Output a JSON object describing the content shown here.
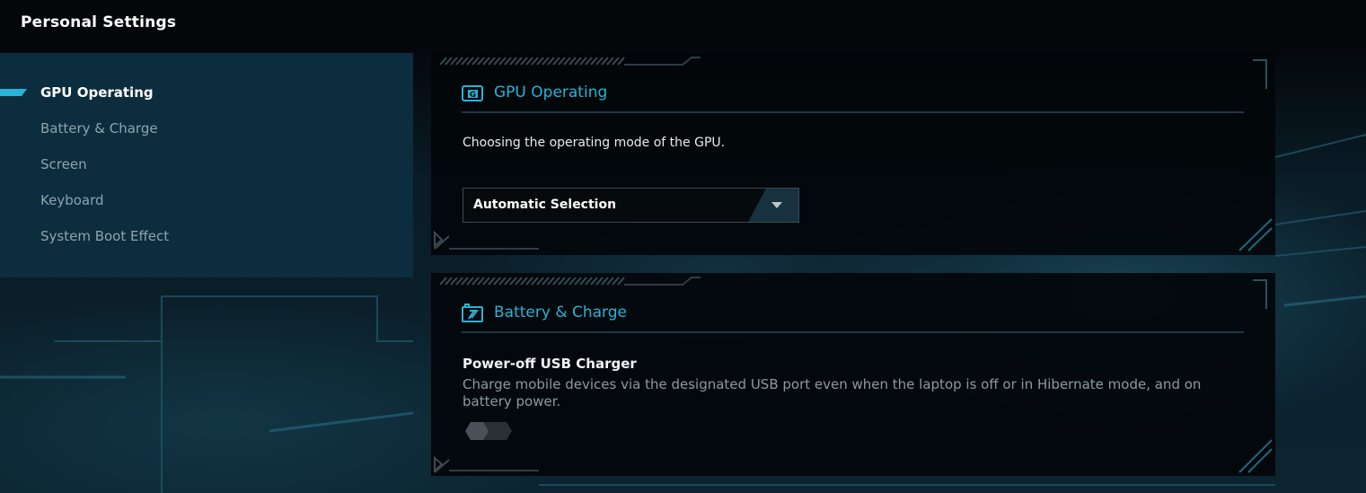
{
  "app": {
    "title": "Personal Settings"
  },
  "sidebar": {
    "items": [
      {
        "label": "GPU Operating",
        "active": true
      },
      {
        "label": "Battery & Charge",
        "active": false
      },
      {
        "label": "Screen",
        "active": false
      },
      {
        "label": "Keyboard",
        "active": false
      },
      {
        "label": "System Boot Effect",
        "active": false
      }
    ]
  },
  "gpu_panel": {
    "title": "GPU Operating",
    "icon": "gpu-icon",
    "description": "Choosing the operating mode of the GPU.",
    "mode_select": {
      "value": "Automatic Selection"
    }
  },
  "battery_panel": {
    "title": "Battery & Charge",
    "icon": "battery-charge-icon",
    "usb_charger": {
      "title": "Power-off USB Charger",
      "description": "Charge mobile devices via the designated USB port even when the laptop is off or in Hibernate mode, and on battery power.",
      "enabled": false
    }
  },
  "colors": {
    "accent": "#27b4d8",
    "sidebar_bg": "#0b2d3d",
    "panel_bg": "#020609"
  }
}
